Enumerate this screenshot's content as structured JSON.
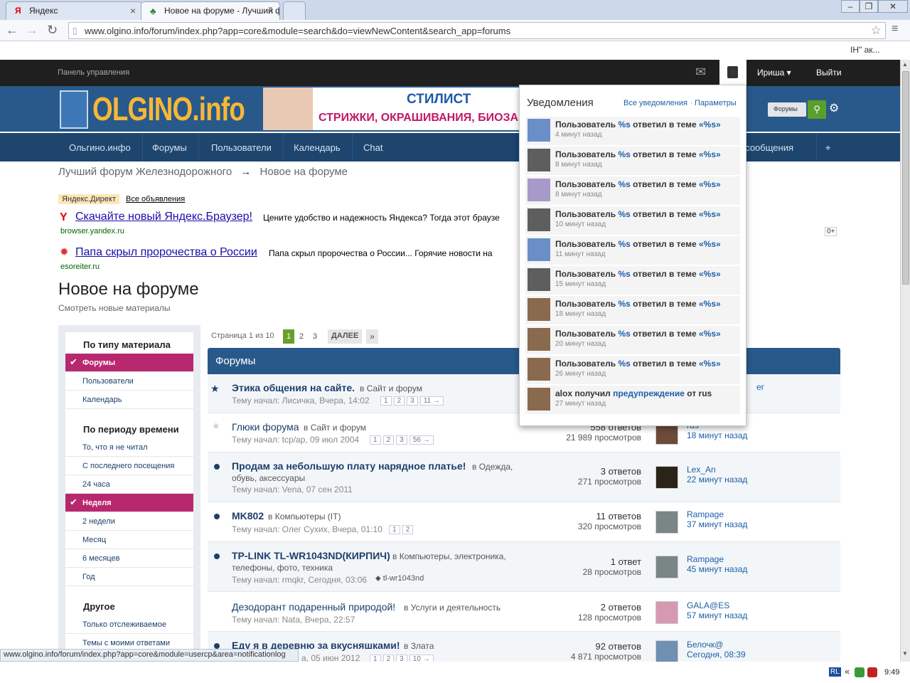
{
  "browser": {
    "tabs": [
      {
        "title": "Яндекс",
        "icon": "yandex-icon"
      },
      {
        "title": "Новое на форуме - Лучший ф",
        "icon": "tree-icon"
      }
    ],
    "url": "www.olgino.info/forum/index.php?app=core&module=search&do=viewNewContent&search_app=forums",
    "bookmarks_right": "IH\" ак...",
    "status_url": "www.olgino.info/forum/index.php?app=core&module=usercp&area=notificationlog",
    "clock": "9:49",
    "tray_lang": "RL"
  },
  "site": {
    "panel": "Панель управления",
    "user": "Ириша",
    "logout": "Выйти",
    "logo": "OLGINO.info",
    "banner_line1": "СТИЛИСТ",
    "banner_line2": "СТРИЖКИ, ОКРАШИВАНИЯ, БИОЗА",
    "search_scope": "Форумы",
    "nav": [
      "Ольгино.инфо",
      "Форумы",
      "Пользователи",
      "Календарь",
      "Chat"
    ],
    "nav_right": "ые сообщения",
    "breadcrumb": {
      "root": "Лучший форум Железнодорожного",
      "arrow": "→",
      "current": "Новое на форуме"
    }
  },
  "ads": {
    "label": "Яндекс.Директ",
    "all": "Все объявления",
    "items": [
      {
        "title": "Скачайте новый Яндекс.Браузер!",
        "text": "Цените удобство и надежность Яндекса? Тогда этот браузе",
        "domain": "browser.yandex.ru"
      },
      {
        "title": "Папа скрыл пророчества о России",
        "text": "Папа скрыл пророчества о России... Горячие новости на",
        "domain": "esoreiter.ru"
      }
    ],
    "badge": "0+"
  },
  "page": {
    "title": "Новое на форуме",
    "subtitle": "Смотреть новые материалы"
  },
  "sidebar": {
    "sections": [
      {
        "head": "По типу материала",
        "items": [
          "Форумы",
          "Пользователи",
          "Календарь"
        ]
      },
      {
        "head": "По периоду времени",
        "items": [
          "То, что я не читал",
          "С последнего посещения",
          "24 часа",
          "Неделя",
          "2 недели",
          "Месяц",
          "6 месяцев",
          "Год"
        ]
      },
      {
        "head": "Другое",
        "items": [
          "Только отслеживаемое",
          "Темы с моими ответами"
        ]
      }
    ]
  },
  "pagination": {
    "label": "Страница 1 из 10",
    "pages": [
      "1",
      "2",
      "3"
    ],
    "next": "ДАЛЕЕ",
    "last": "»"
  },
  "forum": {
    "title": "Форумы",
    "topics": [
      {
        "title": "Этика общения на сайте.",
        "in": "в Сайт и форум",
        "meta": "Тему начал: Лисичка, Вчера, 14:02",
        "pages": [
          "1",
          "2",
          "3",
          "11 →"
        ],
        "replies": "",
        "views": "",
        "last_user": "er",
        "last_time": ""
      },
      {
        "title": "Глюки форума",
        "in": "в Сайт и форум",
        "meta": "Тему начал: tcp/ap, 09 июл 2004",
        "pages": [
          "1",
          "2",
          "3",
          "56 →"
        ],
        "replies": "558 ответов",
        "views": "21 989 просмотров",
        "last_user": "rus",
        "last_time": "18 минут назад"
      },
      {
        "title": "Продам за небольшую плату нарядное платье!",
        "in": "в Одежда,",
        "in2": "обувь, аксессуары",
        "meta": "Тему начал: Vena, 07 сен 2011",
        "pages": [],
        "replies": "3 ответов",
        "views": "271 просмотров",
        "last_user": "Lex_An",
        "last_time": "22 минут назад"
      },
      {
        "title": "MK802",
        "in": "в Компьютеры (IT)",
        "meta": "Тему начал: Олег Сухих, Вчера, 01:10",
        "pages": [
          "1",
          "2"
        ],
        "replies": "11 ответов",
        "views": "320 просмотров",
        "last_user": "Rampage",
        "last_time": "37 минут назад"
      },
      {
        "title": "TP-LINK TL-WR1043ND(КИРПИЧ)",
        "in": "в Компьютеры, электроника,",
        "in2": "телефоны, фото, техника",
        "meta": "Тему начал: rmqkr, Сегодня, 03:06",
        "tag": "tl-wr1043nd",
        "pages": [],
        "replies": "1 ответ",
        "views": "28 просмотров",
        "last_user": "Rampage",
        "last_time": "45 минут назад"
      },
      {
        "title": "Дезодорант подаренный природой!",
        "in": "в Услуги и деятельность",
        "meta": "Тему начал: Nata, Вчера, 22:57",
        "pages": [],
        "replies": "2 ответов",
        "views": "128 просмотров",
        "last_user": "GALA@ES",
        "last_time": "57 минут назад"
      },
      {
        "title": "Еду я в деревню за вкусняшками!",
        "in": "в Злата",
        "meta": "а, 05 июн 2012",
        "pages": [
          "1",
          "2",
          "3",
          "10 →"
        ],
        "replies": "92 ответов",
        "views": "4 871 просмотров",
        "last_user": "Белочк@",
        "last_time": "Сегодня, 08:39"
      }
    ]
  },
  "notifications": {
    "title": "Уведомления",
    "all": "Все уведомления",
    "sep": "·",
    "params": "Параметры",
    "items": [
      {
        "pre": "Пользователь ",
        "hl": "%s",
        "post": " ответил в теме ",
        "hl2": "«%s»",
        "time": "4 минут назад",
        "avatar": "dog"
      },
      {
        "pre": "Пользователь ",
        "hl": "%s",
        "post": " ответил в теме ",
        "hl2": "«%s»",
        "time": "8 минут назад",
        "avatar": "default"
      },
      {
        "pre": "Пользователь ",
        "hl": "%s",
        "post": " ответил в теме ",
        "hl2": "«%s»",
        "time": "8 минут назад",
        "avatar": "purple"
      },
      {
        "pre": "Пользователь ",
        "hl": "%s",
        "post": " ответил в теме ",
        "hl2": "«%s»",
        "time": "10 минут назад",
        "avatar": "default"
      },
      {
        "pre": "Пользователь ",
        "hl": "%s",
        "post": " ответил в теме ",
        "hl2": "«%s»",
        "time": "11 минут назад",
        "avatar": "dog"
      },
      {
        "pre": "Пользователь ",
        "hl": "%s",
        "post": " ответил в теме ",
        "hl2": "«%s»",
        "time": "15 минут назад",
        "avatar": "default"
      },
      {
        "pre": "Пользователь ",
        "hl": "%s",
        "post": " ответил в теме ",
        "hl2": "«%s»",
        "time": "18 минут назад",
        "avatar": "cowboy"
      },
      {
        "pre": "Пользователь ",
        "hl": "%s",
        "post": " ответил в теме ",
        "hl2": "«%s»",
        "time": "20 минут назад",
        "avatar": "cowboy"
      },
      {
        "pre": "Пользователь ",
        "hl": "%s",
        "post": " ответил в теме ",
        "hl2": "«%s»",
        "time": "26 минут назад",
        "avatar": "cowboy"
      },
      {
        "pre": "alox получил ",
        "hl": "предупреждение",
        "post": " от rus",
        "hl2": "",
        "time": "27 минут назад",
        "avatar": "cowboy"
      }
    ]
  }
}
